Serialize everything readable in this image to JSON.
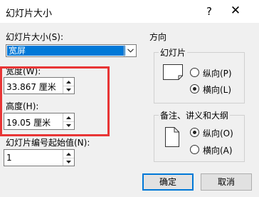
{
  "window": {
    "title": "幻灯片大小",
    "help": "?",
    "close": "✕"
  },
  "slide_size": {
    "label": "幻灯片大小(S):",
    "selected": "宽屏"
  },
  "width": {
    "label": "宽度(W):",
    "value": "33.867 厘米"
  },
  "height": {
    "label": "高度(H):",
    "value": "19.05 厘米"
  },
  "numbering": {
    "label": "幻灯片编号起始值(N):",
    "value": "1"
  },
  "orientation": {
    "title": "方向",
    "slides": {
      "title": "幻灯片",
      "options": [
        "纵向(P)",
        "横向(L)"
      ],
      "selected": "横向(L)"
    },
    "notes": {
      "title": "备注、讲义和大纲",
      "options": [
        "纵向(O)",
        "横向(A)"
      ],
      "selected": "纵向(O)"
    }
  },
  "buttons": {
    "ok": "确定",
    "cancel": "取消"
  }
}
